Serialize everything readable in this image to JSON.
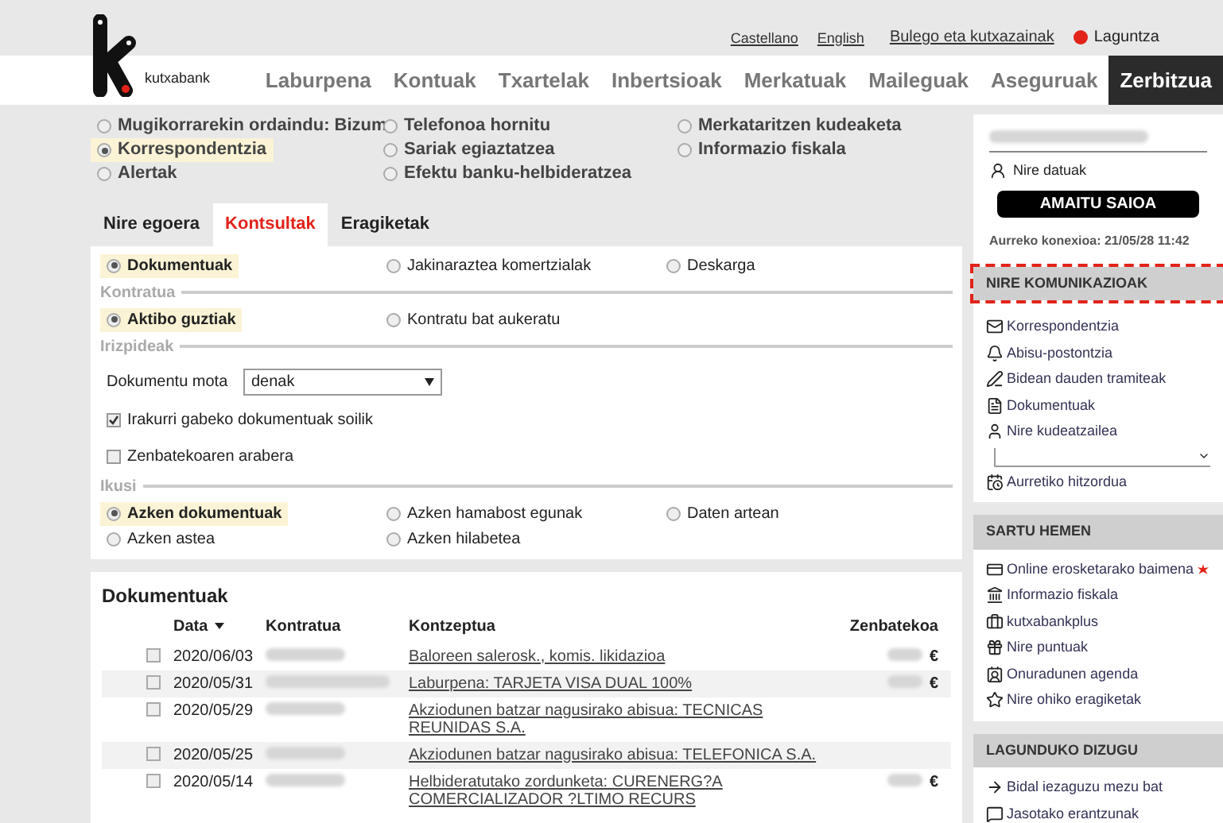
{
  "top_links": [
    {
      "text": "Castellano"
    },
    {
      "text": "English"
    },
    {
      "text": "Bulego eta kutxazainak"
    }
  ],
  "help": {
    "text": "Laguntza"
  },
  "logo": {
    "text": "kutxabank"
  },
  "nav": [
    {
      "label": "Laburpena",
      "selected": false
    },
    {
      "label": "Kontuak",
      "selected": false
    },
    {
      "label": "Txartelak",
      "selected": false
    },
    {
      "label": "Inbertsioak",
      "selected": false
    },
    {
      "label": "Merkatuak",
      "selected": false
    },
    {
      "label": "Maileguak",
      "selected": false
    },
    {
      "label": "Aseguruak",
      "selected": false
    },
    {
      "label": "Zerbitzua",
      "selected": true
    }
  ],
  "services": [
    {
      "label": "Mugikorrarekin ordaindu: Bizum",
      "selected": false
    },
    {
      "label": "Korrespondentzia",
      "selected": true
    },
    {
      "label": "Alertak",
      "selected": false
    },
    {
      "label": "Telefonoa hornitu",
      "selected": false
    },
    {
      "label": "Sariak egiaztatzea",
      "selected": false
    },
    {
      "label": "Efektu banku-helbideratzea",
      "selected": false
    },
    {
      "label": "Merkataritzen kudeaketa",
      "selected": false
    },
    {
      "label": "Informazio fiskala",
      "selected": false
    }
  ],
  "tabs": [
    {
      "label": "Nire egoera",
      "selected": false
    },
    {
      "label": "Kontsultak",
      "selected": true
    },
    {
      "label": "Eragiketak",
      "selected": false
    }
  ],
  "filter": {
    "type_options": [
      {
        "label": "Dokumentuak",
        "selected": true
      },
      {
        "label": "Jakinaraztea komertzialak",
        "selected": false
      },
      {
        "label": "Deskarga",
        "selected": false
      }
    ],
    "contract_heading": "Kontratua",
    "contract_options": [
      {
        "label": "Aktibo guztiak",
        "selected": true
      },
      {
        "label": "Kontratu bat aukeratu",
        "selected": false
      }
    ],
    "criteria_heading": "Irizpideak",
    "doc_type": {
      "label": "Dokumentu mota",
      "value": "denak"
    },
    "checkboxes": [
      {
        "label": "Irakurri gabeko dokumentuak soilik",
        "checked": true
      },
      {
        "label": "Zenbatekoaren arabera",
        "checked": false
      }
    ],
    "view_heading": "Ikusi",
    "view_options": [
      {
        "label": "Azken dokumentuak",
        "selected": true
      },
      {
        "label": "Azken hamabost egunak",
        "selected": false
      },
      {
        "label": "Daten artean",
        "selected": false
      },
      {
        "label": "Azken astea",
        "selected": false
      },
      {
        "label": "Azken hilabetea",
        "selected": false
      }
    ]
  },
  "documents": {
    "title": "Dokumentuak",
    "columns": [
      "Data",
      "Kontratua",
      "Kontzeptua",
      "Zenbatekoa"
    ],
    "rows": [
      {
        "date": "2020/06/03",
        "concept": "Baloreen salerosk., komis. likidazioa",
        "currency": "€",
        "checked": false
      },
      {
        "date": "2020/05/31",
        "concept": "Laburpena: TARJETA VISA DUAL 100%",
        "currency": "€",
        "checked": false
      },
      {
        "date": "2020/05/29",
        "concept": "Akziodunen batzar nagusirako abisua: TECNICAS REUNIDAS S.A.",
        "checked": false
      },
      {
        "date": "2020/05/25",
        "concept": "Akziodunen batzar nagusirako abisua: TELEFONICA S.A.",
        "checked": false
      },
      {
        "date": "2020/05/14",
        "concept": "Helbideratutako zordunketa: CURENERG?A COMERCIALIZADOR ?LTIMO RECURS",
        "currency": "€",
        "checked": false
      }
    ]
  },
  "sidebar": {
    "my_data": "Nire datuak",
    "logout": "AMAITU SAIOA",
    "last_login": "Aurreko konexioa: 21/05/28 11:42",
    "sections": [
      {
        "title": "NIRE KOMUNIKAZIOAK",
        "highlighted": true,
        "items": [
          "Korrespondentzia",
          "Abisu-postontzia",
          "Bidean dauden tramiteak",
          "Dokumentuak",
          "Nire kudeatzailea",
          "Aurretiko hitzordua"
        ]
      },
      {
        "title": "SARTU HEMEN",
        "highlighted": false,
        "items": [
          "Online erosketarako baimena",
          "Informazio fiskala",
          "kutxabankplus",
          "Nire puntuak",
          "Onuradunen agenda",
          "Nire ohiko eragiketak"
        ]
      },
      {
        "title": "LAGUNDUKO DIZUGU",
        "highlighted": false,
        "items": [
          "Bidal iezaguzu mezu bat",
          "Jasotako erantzunak"
        ]
      }
    ]
  }
}
